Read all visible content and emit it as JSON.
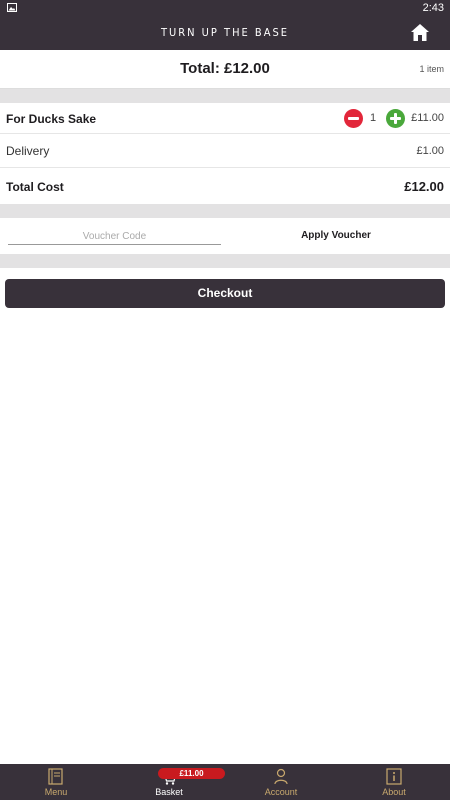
{
  "status_bar": {
    "time": "2:43",
    "icon": "image-icon"
  },
  "app_bar": {
    "title": "TURN UP THE BASE",
    "home_icon": "home-icon"
  },
  "summary": {
    "total_label": "Total: £12.00",
    "item_count": "1 item"
  },
  "items": [
    {
      "name": "For Ducks Sake",
      "quantity": "1",
      "price": "£11.00"
    }
  ],
  "delivery": {
    "label": "Delivery",
    "value": "£1.00"
  },
  "total_cost": {
    "label": "Total Cost",
    "value": "£12.00"
  },
  "voucher": {
    "placeholder": "Voucher Code",
    "value": "",
    "apply_label": "Apply Voucher"
  },
  "checkout": {
    "label": "Checkout"
  },
  "bottom_nav": {
    "items": [
      {
        "label": "Menu",
        "icon": "menu-book-icon"
      },
      {
        "label": "Basket",
        "icon": "cart-icon",
        "badge": "£11.00"
      },
      {
        "label": "Account",
        "icon": "person-icon"
      },
      {
        "label": "About",
        "icon": "info-icon"
      }
    ],
    "active": "Basket"
  },
  "colors": {
    "bar": "#38313a",
    "nav_label": "#c9a96e",
    "minus": "#e2263a",
    "plus": "#4aa83b",
    "badge": "#c91a1f",
    "divider": "#e3e2e3"
  }
}
